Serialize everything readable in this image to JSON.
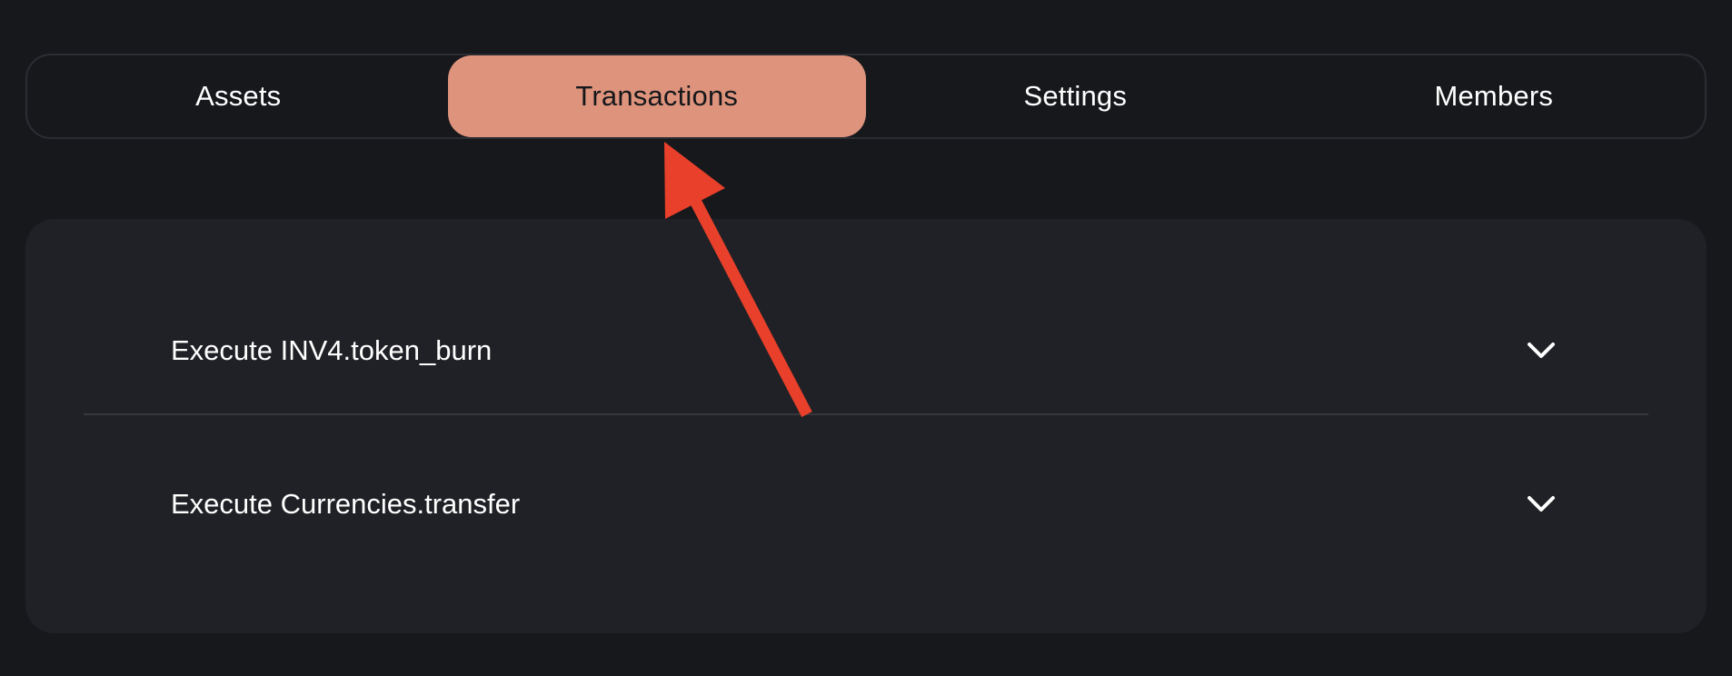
{
  "tabs": [
    {
      "label": "Assets",
      "active": false
    },
    {
      "label": "Transactions",
      "active": true
    },
    {
      "label": "Settings",
      "active": false
    },
    {
      "label": "Members",
      "active": false
    }
  ],
  "transactions": [
    {
      "label": "Execute INV4.token_burn",
      "icon": "chevron-down-icon"
    },
    {
      "label": "Execute Currencies.transfer",
      "icon": "chevron-down-icon"
    }
  ],
  "colors": {
    "background": "#17181c",
    "panel": "#202126",
    "active_tab": "#dd937c",
    "annotation_arrow": "#e8402a"
  }
}
